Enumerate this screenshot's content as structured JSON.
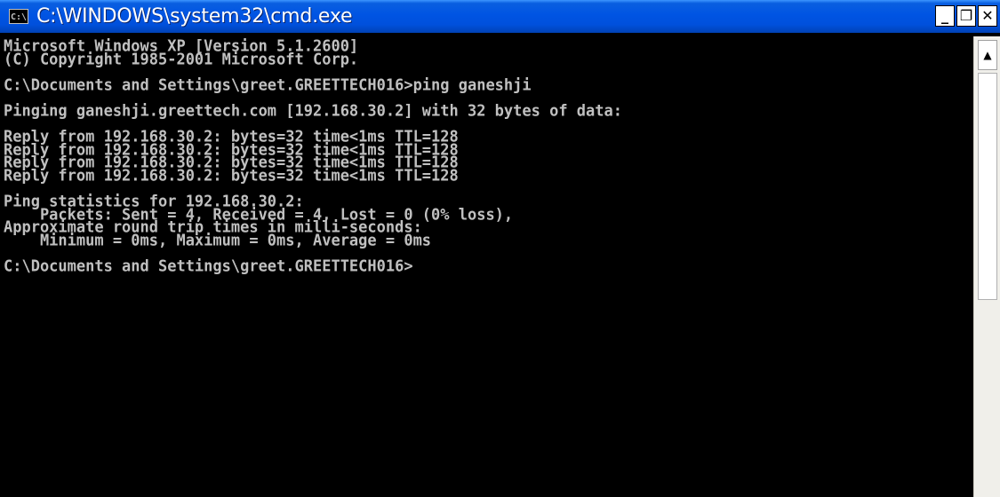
{
  "window": {
    "title": "C:\\WINDOWS\\system32\\cmd.exe",
    "icon": "C:\\",
    "minimize_glyph": "_",
    "maximize_glyph": "❐",
    "close_glyph": "✕"
  },
  "console": {
    "lines": [
      "Microsoft Windows XP [Version 5.1.2600]",
      "(C) Copyright 1985-2001 Microsoft Corp.",
      "",
      "C:\\Documents and Settings\\greet.GREETTECH016>ping ganeshji",
      "",
      "Pinging ganeshji.greettech.com [192.168.30.2] with 32 bytes of data:",
      "",
      "Reply from 192.168.30.2: bytes=32 time<1ms TTL=128",
      "Reply from 192.168.30.2: bytes=32 time<1ms TTL=128",
      "Reply from 192.168.30.2: bytes=32 time<1ms TTL=128",
      "Reply from 192.168.30.2: bytes=32 time<1ms TTL=128",
      "",
      "Ping statistics for 192.168.30.2:",
      "    Packets: Sent = 4, Received = 4, Lost = 0 (0% loss),",
      "Approximate round trip times in milli-seconds:",
      "    Minimum = 0ms, Maximum = 0ms, Average = 0ms",
      "",
      "C:\\Documents and Settings\\greet.GREETTECH016>"
    ]
  },
  "scrollbar": {
    "up_glyph": "▲"
  },
  "colors": {
    "titlebar": "#0054e3",
    "console_bg": "#000000",
    "console_text": "#c0c0c0"
  },
  "icons": {
    "app": "cmd-app-icon",
    "minimize": "minimize-icon",
    "maximize": "maximize-icon",
    "close": "close-icon",
    "scroll_up": "arrow-up-icon"
  }
}
